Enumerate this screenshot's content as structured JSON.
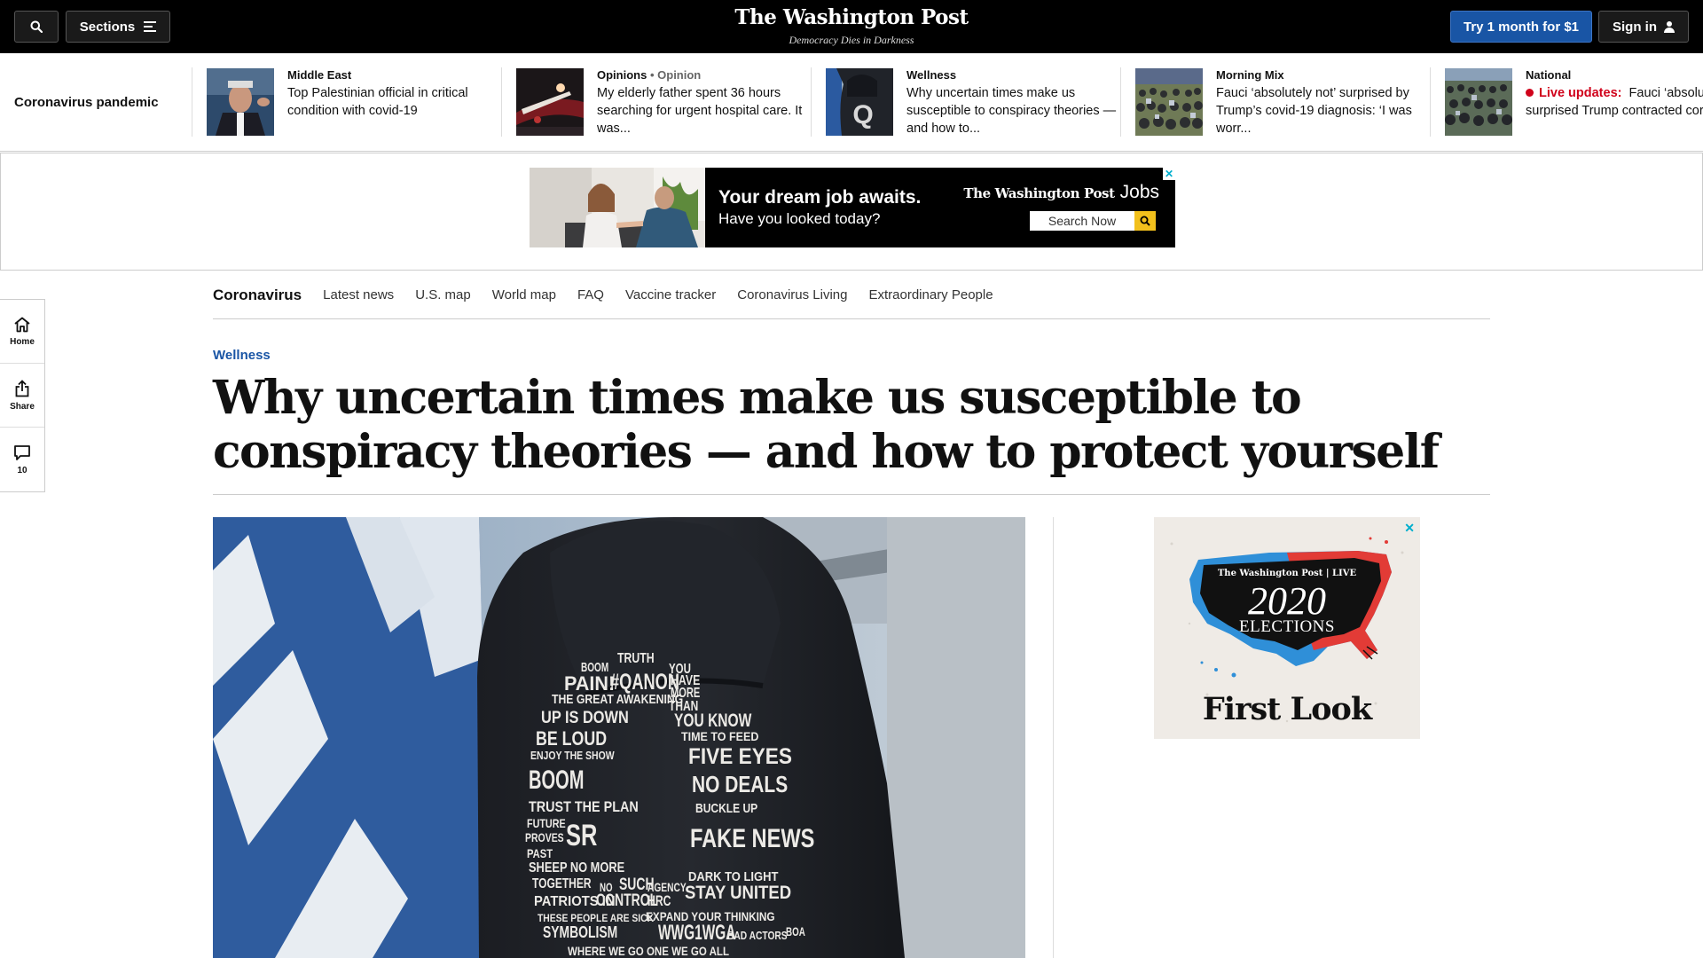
{
  "topbar": {
    "sections_label": "Sections",
    "logo": "The Washington Post",
    "tagline": "Democracy Dies in Darkness",
    "subscribe_label": "Try 1 month for $1",
    "signin_label": "Sign in"
  },
  "trending": {
    "label": "Coronavirus pandemic",
    "items": [
      {
        "kicker": "Middle East",
        "headline": "Top Palestinian official in critical condition with covid-19"
      },
      {
        "kicker": "Opinions",
        "kicker_sub": "Opinion",
        "headline": "My elderly father spent 36 hours searching for urgent hospital care. It was..."
      },
      {
        "kicker": "Wellness",
        "headline": "Why uncertain times make us susceptible to conspiracy theories — and how to..."
      },
      {
        "kicker": "Morning Mix",
        "headline": "Fauci ‘absolutely not’ surprised by Trump’s covid-19 diagnosis: ‘I was worr..."
      },
      {
        "kicker": "National",
        "live": "Live updates:",
        "headline": "Fauci ‘absolutely not’ surprised Trump contracted coronavirus..."
      }
    ]
  },
  "job_ad": {
    "headline": "Your dream job awaits.",
    "subline": "Have you looked today?",
    "brand": "The Washington Post",
    "brand_suffix": "Jobs",
    "search_label": "Search Now"
  },
  "subnav": {
    "title": "Coronavirus",
    "links": [
      "Latest news",
      "U.S. map",
      "World map",
      "FAQ",
      "Vaccine tracker",
      "Coronavirus Living",
      "Extraordinary People"
    ]
  },
  "rail": {
    "home_label": "Home",
    "share_label": "Share",
    "comment_count": "10"
  },
  "article": {
    "section": "Wellness",
    "title": "Why uncertain times make us susceptible to conspiracy theories — and how to protect yourself"
  },
  "hoodie_words": [
    "BOOM",
    "TRUTH",
    "YOU",
    "PAIN!",
    "#QANON",
    "HAVE",
    "MORE",
    "THE GREAT AWAKENING",
    "THAN",
    "UP IS DOWN",
    "YOU KNOW",
    "BE LOUD",
    "TIME TO FEED",
    "ENJOY THE SHOW",
    "FIVE EYES",
    "BOOM",
    "NO DEALS",
    "TRUST THE PLAN",
    "BUCKLE UP",
    "FUTURE",
    "PROVES",
    "SR",
    "PAST",
    "FAKE NEWS",
    "SHEEP NO MORE",
    "DARK TO LIGHT",
    "TOGETHER",
    "NO",
    "SUCH",
    "AGENCY",
    "STAY UNITED",
    "PATRIOTS IN",
    "CONTROL",
    "HRC",
    "EXPAND YOUR THINKING",
    "THESE PEOPLE ARE SICK",
    "SYMBOLISM",
    "WWG1WGA",
    "BAD ACTORS",
    "BOA",
    "WHERE WE GO ONE WE GO ALL"
  ],
  "side_ad": {
    "brand": "The Washington Post | LIVE",
    "year": "2020",
    "event": "ELECTIONS",
    "cta": "First Look"
  },
  "colors": {
    "accent_blue": "#1955a5",
    "live_red": "#d0021b",
    "topbar_bg": "#000000"
  },
  "icons": [
    "search-icon",
    "menu-icon",
    "person-icon",
    "home-icon",
    "share-icon",
    "comment-icon",
    "adchoices-icon"
  ]
}
